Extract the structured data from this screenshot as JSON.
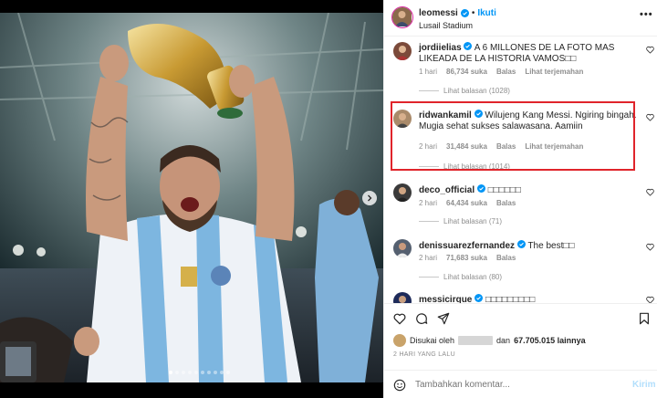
{
  "post": {
    "author": "leomessi",
    "follow_label": "Ikuti",
    "separator": "•",
    "location": "Lusail Stadium",
    "more_label": "•••"
  },
  "comments": [
    {
      "user": "jordiielias",
      "text": "A 6 MILLONES DE LA FOTO MAS LIKEADA DE LA HISTORIA VAMOS□□",
      "time": "1 hari",
      "likes": "86,734 suka",
      "reply": "Balas",
      "translate": "Lihat terjemahan",
      "replies": "Lihat balasan (1028)"
    },
    {
      "user": "ridwankamil",
      "text": "Wilujeng Kang Messi. Ngiring bingah. Mugia sehat sukses salawasana. Aamiin",
      "time": "2 hari",
      "likes": "31,484 suka",
      "reply": "Balas",
      "translate": "Lihat terjemahan",
      "replies": "Lihat balasan (1014)"
    },
    {
      "user": "deco_official",
      "text": "□□□□□□",
      "time": "2 hari",
      "likes": "64,434 suka",
      "reply": "Balas",
      "replies": "Lihat balasan (71)"
    },
    {
      "user": "denissuarezfernandez",
      "text": "The best□□",
      "time": "2 hari",
      "likes": "71,683 suka",
      "reply": "Balas",
      "replies": "Lihat balasan (80)"
    },
    {
      "user": "messicirque",
      "text": "□□□□□□□□□"
    }
  ],
  "likes_bar": {
    "prefix": "Disukai oleh",
    "middle": "dan",
    "count": "67.705.015 lainnya"
  },
  "post_date": "2 HARI YANG LALU",
  "add_comment": {
    "placeholder": "Tambahkan komentar...",
    "post_label": "Kirim"
  },
  "icons": {
    "like": "heart-icon",
    "comment": "comment-icon",
    "share": "share-icon",
    "save": "bookmark-icon",
    "emoji": "smiley-icon",
    "verified": "verified-badge-icon"
  },
  "colors": {
    "accent": "#0095f6",
    "highlight_border": "#e0242b",
    "muted": "#8e8e8e"
  }
}
